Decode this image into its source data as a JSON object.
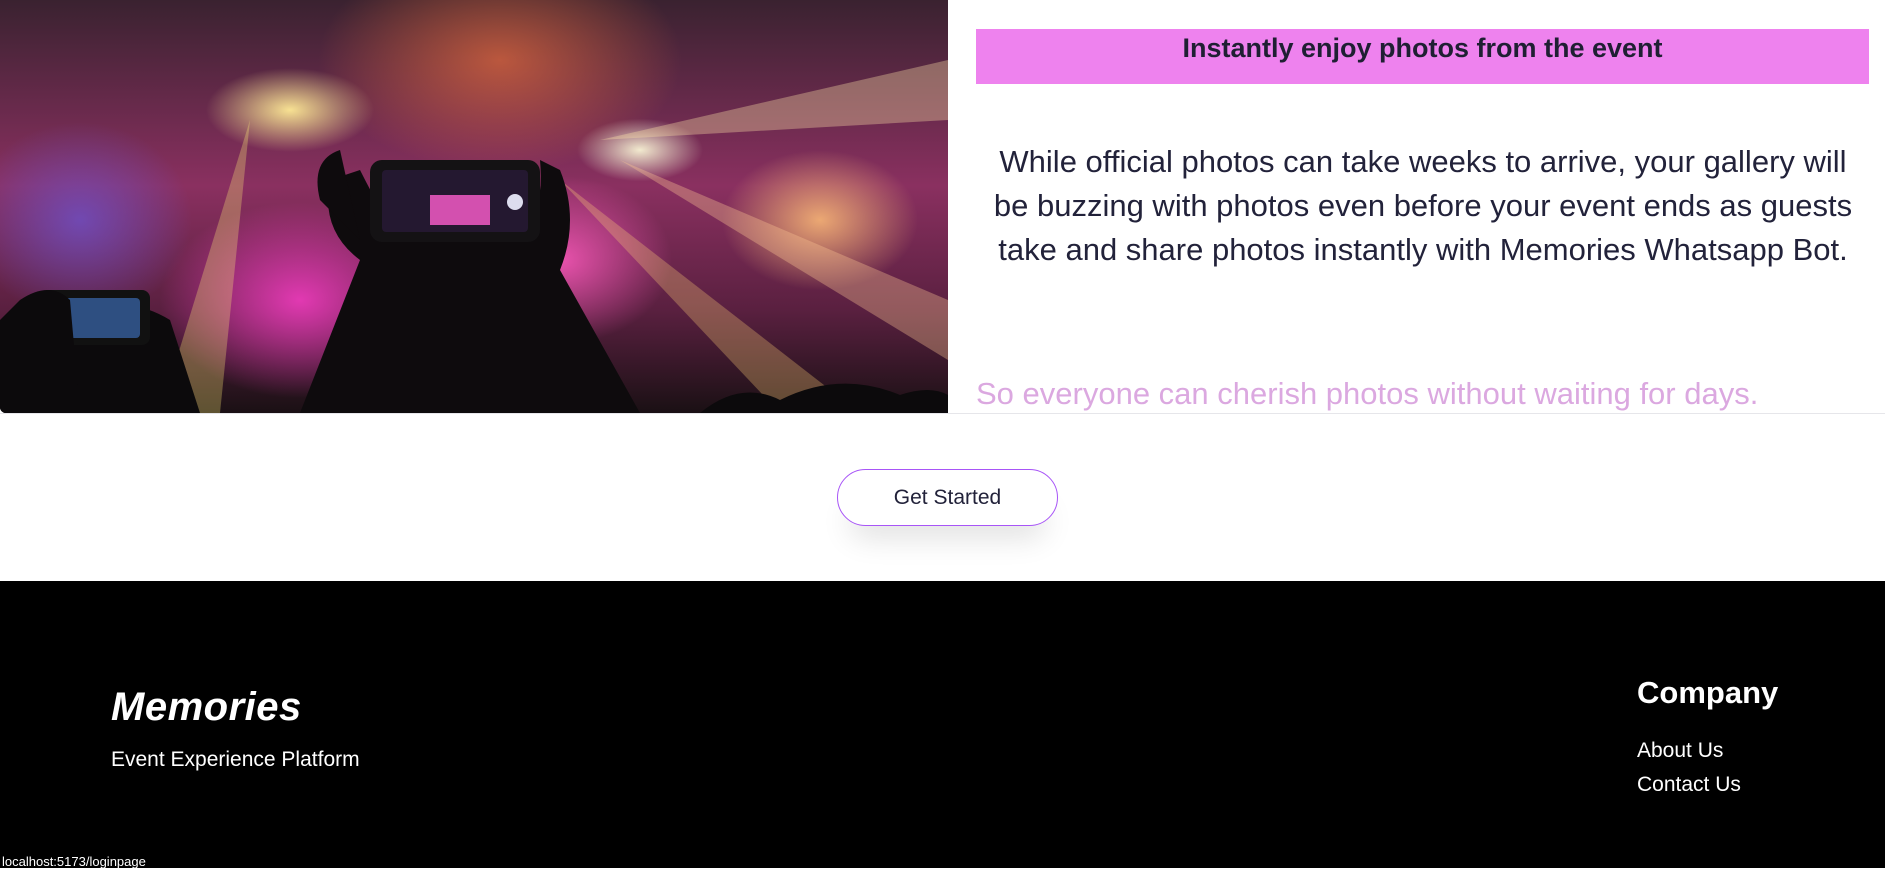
{
  "feature": {
    "image_alt_icon": "concert-crowd-photo",
    "headline": "Instantly enjoy photos from the event",
    "body": "While official photos can take weeks to arrive, your gallery will be buzzing with photos even before your event ends as guests take and share photos instantly with Memories Whatsapp Bot.",
    "subtext": "So everyone can cherish photos without waiting for days.",
    "accent_color": "#ee82ee",
    "subtext_color": "#dba8e0"
  },
  "cta": {
    "label": "Get Started",
    "border_color": "#a855f7"
  },
  "footer": {
    "brand": "Memories",
    "tagline": "Event Experience Platform",
    "company_title": "Company",
    "links": [
      "About Us",
      "Contact Us"
    ],
    "background": "#000000"
  },
  "status_bar": {
    "url": "localhost:5173/loginpage"
  }
}
